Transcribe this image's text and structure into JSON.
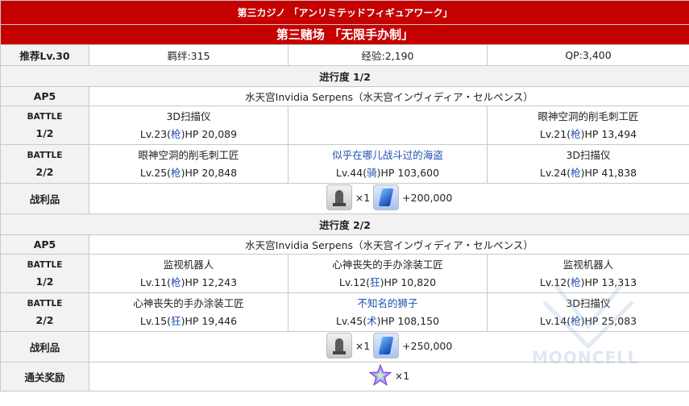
{
  "header": {
    "title_jp": "第三カジノ 「アンリミテッドフィギュアワーク」",
    "title_cn": "第三赌场 「无限手办制」"
  },
  "info": {
    "level": "推荐Lv.30",
    "bond": "羁绊:315",
    "exp": "经验:2,190",
    "qp": "QP:3,400"
  },
  "progress": [
    {
      "title": "进行度 1/2",
      "ap": "AP5",
      "location": "水天宫Invidia Serpens（水天宫インヴィディア・セルペンス）",
      "battles": [
        {
          "label_top": "BATTLE",
          "label_bottom": "1/2",
          "enemies": [
            {
              "name": "3D扫描仪",
              "lv": "Lv.23(",
              "cls": "枪",
              "hp": ")HP 20,089",
              "highlight": false
            },
            {
              "name": "",
              "lv": "",
              "cls": "",
              "hp": "",
              "highlight": false
            },
            {
              "name": "眼神空洞的削毛刺工匠",
              "lv": "Lv.21(",
              "cls": "枪",
              "hp": ")HP 13,494",
              "highlight": false
            }
          ]
        },
        {
          "label_top": "BATTLE",
          "label_bottom": "2/2",
          "enemies": [
            {
              "name": "眼神空洞的削毛刺工匠",
              "lv": "Lv.25(",
              "cls": "枪",
              "hp": ")HP 20,848",
              "highlight": false
            },
            {
              "name": "似乎在哪儿战斗过的海盗",
              "lv": "Lv.44(",
              "cls": "骑",
              "hp": ")HP 103,600",
              "highlight": true
            },
            {
              "name": "3D扫描仪",
              "lv": "Lv.24(",
              "cls": "枪",
              "hp": ")HP 41,838",
              "highlight": false
            }
          ]
        }
      ],
      "drops_label": "战利品",
      "drops": {
        "statue_count": "×1",
        "qp_amount": "+200,000",
        "statue_icon": "saber-statue-icon",
        "qp_icon": "qp-crystal-icon"
      }
    },
    {
      "title": "进行度 2/2",
      "ap": "AP5",
      "location": "水天宫Invidia Serpens（水天宫インヴィディア・セルペンス）",
      "battles": [
        {
          "label_top": "BATTLE",
          "label_bottom": "1/2",
          "enemies": [
            {
              "name": "监视机器人",
              "lv": "Lv.11(",
              "cls": "枪",
              "hp": ")HP 12,243",
              "highlight": false
            },
            {
              "name": "心神丧失的手办涂装工匠",
              "lv": "Lv.12(",
              "cls": "狂",
              "hp": ")HP 10,820",
              "highlight": false
            },
            {
              "name": "监视机器人",
              "lv": "Lv.12(",
              "cls": "枪",
              "hp": ")HP 13,313",
              "highlight": false
            }
          ]
        },
        {
          "label_top": "BATTLE",
          "label_bottom": "2/2",
          "enemies": [
            {
              "name": "心神丧失的手办涂装工匠",
              "lv": "Lv.15(",
              "cls": "狂",
              "hp": ")HP 19,446",
              "highlight": false
            },
            {
              "name": "不知名的狮子",
              "lv": "Lv.45(",
              "cls": "术",
              "hp": ")HP 108,150",
              "highlight": true
            },
            {
              "name": "3D扫描仪",
              "lv": "Lv.14(",
              "cls": "枪",
              "hp": ")HP 25,083",
              "highlight": false
            }
          ]
        }
      ],
      "drops_label": "战利品",
      "drops": {
        "statue_count": "×1",
        "qp_amount": "+250,000",
        "statue_icon": "saber-statue-icon",
        "qp_icon": "qp-crystal-icon"
      }
    }
  ],
  "reward": {
    "label": "通关奖励",
    "count": "×1",
    "icon": "saint-quartz-icon"
  },
  "watermark": {
    "text": "MOONCELL",
    "icon": "mooncell-logo-icon"
  },
  "colors": {
    "header_bg": "#c40000",
    "label_bg": "#f2f2f2",
    "link_blue": "#1f4fb0",
    "border": "#c8c8c8"
  }
}
